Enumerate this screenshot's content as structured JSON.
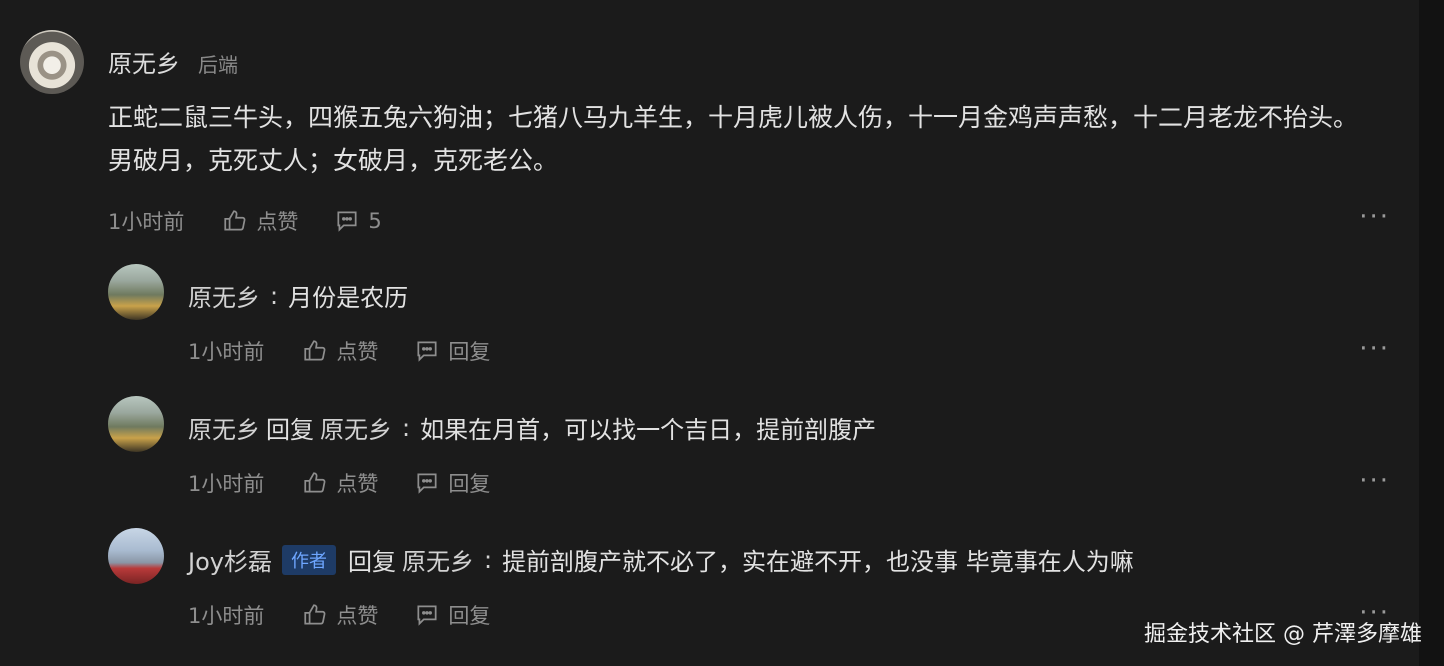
{
  "root": {
    "author": "原无乡",
    "role": "后端",
    "text": "正蛇二鼠三牛头，四猴五兔六狗油；七猪八马九羊生，十月虎儿被人伤，十一月金鸡声声愁，十二月老龙不抬头。男破月，克死丈人；女破月，克死老公。",
    "time": "1小时前",
    "like_label": "点赞",
    "comment_count": "5",
    "more": "···"
  },
  "replies": [
    {
      "author": "原无乡",
      "reply_word": "",
      "reply_to": "",
      "colon": ":",
      "text": "月份是农历",
      "time": "1小时前",
      "like_label": "点赞",
      "reply_label": "回复",
      "more": "···"
    },
    {
      "author": "原无乡",
      "reply_word": "回复",
      "reply_to": "原无乡",
      "colon": ":",
      "text": "如果在月首，可以找一个吉日，提前剖腹产",
      "time": "1小时前",
      "like_label": "点赞",
      "reply_label": "回复",
      "more": "···"
    },
    {
      "author": "Joy杉磊",
      "badge": "作者",
      "reply_word": "回复",
      "reply_to": "原无乡",
      "colon": ":",
      "text": "提前剖腹产就不必了，实在避不开，也没事 毕竟事在人为嘛",
      "time": "1小时前",
      "like_label": "点赞",
      "reply_label": "回复",
      "more": "···"
    }
  ],
  "watermark": "掘金技术社区 @ 芹澤多摩雄",
  "colors": {
    "background": "#1b1b1b",
    "badge_bg": "#1e3b66",
    "badge_text": "#6ea6ff"
  }
}
